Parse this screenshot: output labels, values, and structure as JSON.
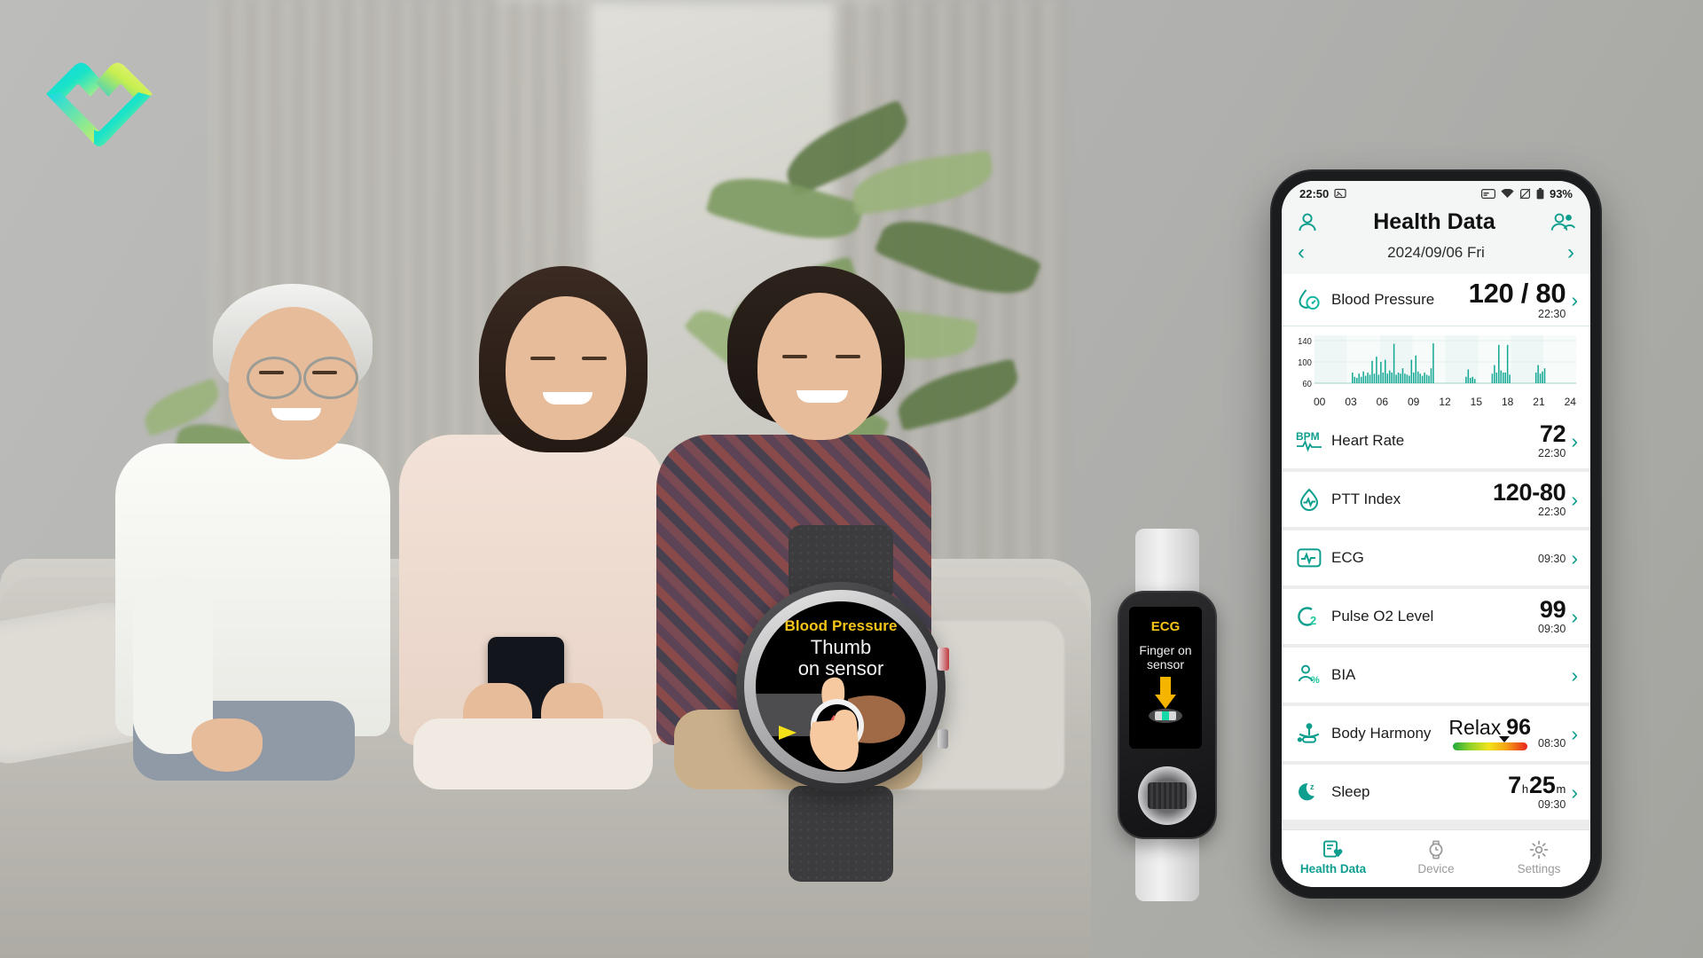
{
  "brand": {
    "logo_name": "health-ribbon-heart-logo"
  },
  "scene": {
    "description": "three-seniors-on-sofa-photo",
    "devices": {
      "smartwatch": {
        "screen_title": "Blood Pressure",
        "screen_instruction_line1": "Thumb",
        "screen_instruction_line2": "on sensor",
        "title_color": "#f5c518",
        "instruction_color": "#f2f2f2"
      },
      "band": {
        "screen_title": "ECG",
        "screen_instruction_line1": "Finger on",
        "screen_instruction_line2": "sensor",
        "title_color": "#f5c518",
        "arrow_icon": "down-arrow-icon"
      }
    }
  },
  "phone": {
    "status_bar": {
      "time": "22:50",
      "battery_percent": "93%",
      "left_icons": [
        "image-icon"
      ],
      "right_icons": [
        "card-icon",
        "wifi-icon",
        "mute-icon",
        "battery-icon"
      ]
    },
    "app_bar": {
      "title": "Health Data",
      "left_icon": "person-icon",
      "right_icon": "people-icon"
    },
    "date_bar": {
      "prev_icon": "chevron-left-icon",
      "date": "2024/09/06 Fri",
      "next_icon": "chevron-right-icon"
    },
    "rows": [
      {
        "icon": "blood-pressure-drop-icon",
        "label": "Blood Pressure",
        "value": "120 / 80",
        "time": "22:30"
      },
      {
        "icon": "bpm-icon",
        "label": "Heart Rate",
        "value": "72",
        "time": "22:30"
      },
      {
        "icon": "ptt-index-icon",
        "label": "PTT Index",
        "value": "120-80",
        "time": "22:30"
      },
      {
        "icon": "ecg-icon",
        "label": "ECG",
        "value": "",
        "time": "09:30"
      },
      {
        "icon": "pulse-o2-icon",
        "label": "Pulse O2 Level",
        "value": "99",
        "time": "09:30"
      },
      {
        "icon": "bia-person-percent-icon",
        "label": "BIA",
        "value": "",
        "time": ""
      },
      {
        "icon": "body-harmony-meditation-icon",
        "label": "Body Harmony",
        "value": "96",
        "state": "Relax",
        "time": "08:30"
      },
      {
        "icon": "sleep-moon-icon",
        "label": "Sleep",
        "value_hours": "7",
        "unit_hours": "h",
        "value_minutes": "25",
        "unit_minutes": "m",
        "time": "09:30"
      }
    ],
    "tabs": [
      {
        "label": "Health Data",
        "icon": "health-data-icon",
        "active": true
      },
      {
        "label": "Device",
        "icon": "watch-icon",
        "active": false
      },
      {
        "label": "Settings",
        "icon": "gear-icon",
        "active": false
      }
    ],
    "accent_color": "#0e9e8e"
  },
  "chart_data": {
    "type": "bar",
    "title": "Blood Pressure 24h",
    "xlabel": "",
    "ylabel": "",
    "ylim": [
      60,
      150
    ],
    "xlim": [
      0,
      24
    ],
    "yticks": [
      60,
      100,
      140
    ],
    "xticks": [
      "00",
      "03",
      "06",
      "09",
      "12",
      "15",
      "18",
      "21",
      "24"
    ],
    "grid": true,
    "bar_color": "#14a894",
    "x": [
      3.5,
      3.7,
      3.9,
      4.1,
      4.3,
      4.5,
      4.7,
      4.9,
      5.1,
      5.3,
      5.5,
      5.7,
      5.9,
      6.1,
      6.3,
      6.5,
      6.7,
      6.9,
      7.1,
      7.3,
      7.5,
      7.7,
      7.9,
      8.1,
      8.3,
      8.5,
      8.7,
      8.9,
      9.1,
      9.3,
      9.5,
      9.7,
      9.9,
      10.1,
      10.3,
      10.5,
      10.7,
      10.9,
      13.9,
      14.1,
      14.3,
      14.5,
      14.7,
      16.3,
      16.5,
      16.7,
      16.9,
      17.1,
      17.3,
      17.5,
      17.7,
      17.9,
      20.3,
      20.5,
      20.7,
      20.9,
      21.1
    ],
    "values": [
      80,
      72,
      70,
      78,
      72,
      82,
      74,
      80,
      76,
      102,
      78,
      110,
      76,
      100,
      80,
      104,
      78,
      84,
      80,
      134,
      76,
      80,
      78,
      88,
      78,
      76,
      74,
      104,
      80,
      112,
      82,
      78,
      74,
      80,
      76,
      74,
      88,
      135,
      72,
      86,
      70,
      72,
      68,
      78,
      94,
      80,
      132,
      84,
      80,
      80,
      132,
      76,
      80,
      94,
      78,
      82,
      88
    ]
  }
}
